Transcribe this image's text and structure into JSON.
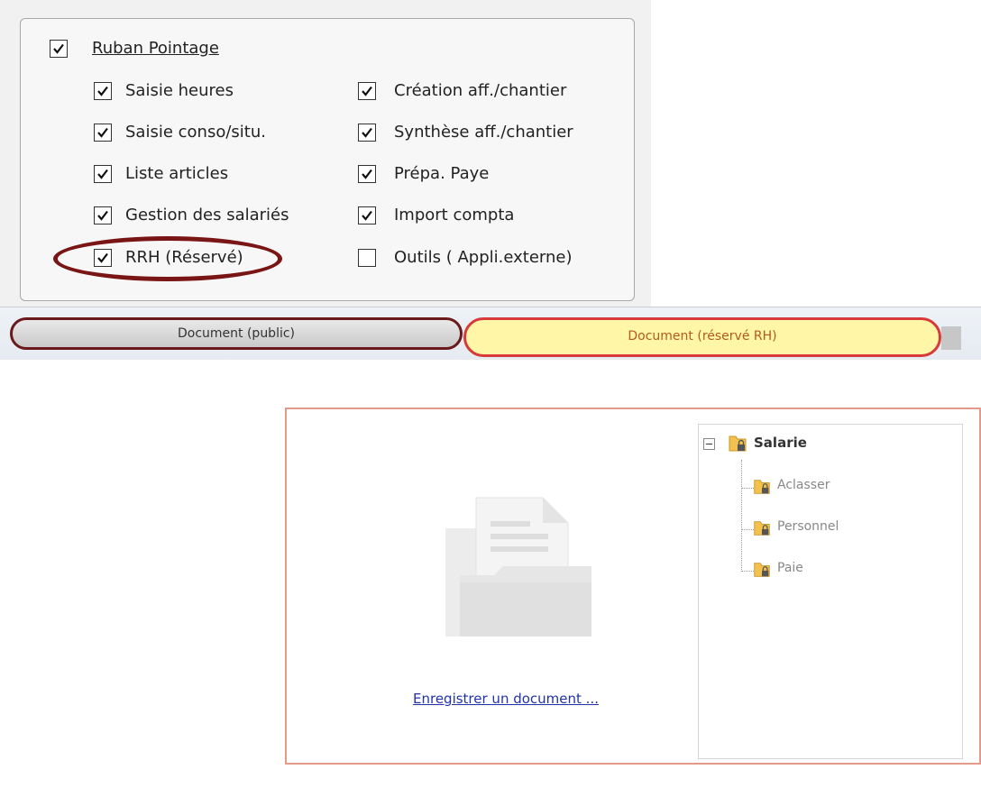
{
  "permissions": {
    "ruban": {
      "label": "Ruban Pointage",
      "checked": true
    },
    "left_items": [
      {
        "label": "Saisie heures",
        "checked": true
      },
      {
        "label": "Saisie conso/situ.",
        "checked": true
      },
      {
        "label": "Liste articles",
        "checked": true
      },
      {
        "label": "Gestion des salariés",
        "checked": true
      },
      {
        "label": "RRH (Réservé)",
        "checked": true
      }
    ],
    "right_items": [
      {
        "label": "Création aff./chantier",
        "checked": true
      },
      {
        "label": "Synthèse aff./chantier",
        "checked": true
      },
      {
        "label": "Prépa. Paye",
        "checked": true
      },
      {
        "label": "Import compta",
        "checked": true
      },
      {
        "label": "Outils ( Appli.externe)",
        "checked": false
      }
    ]
  },
  "tabs": {
    "public": "Document (public)",
    "rh": "Document (réservé RH)"
  },
  "document": {
    "register_link": "Enregistrer un document ..."
  },
  "tree": {
    "root": "Salarie",
    "children": [
      "Aclasser",
      "Personnel",
      "Paie"
    ]
  },
  "colors": {
    "highlight_dark_red": "#7a1515",
    "highlight_red": "#d73a3a",
    "active_tab_bg": "#fff6a8",
    "link": "#2233aa"
  }
}
